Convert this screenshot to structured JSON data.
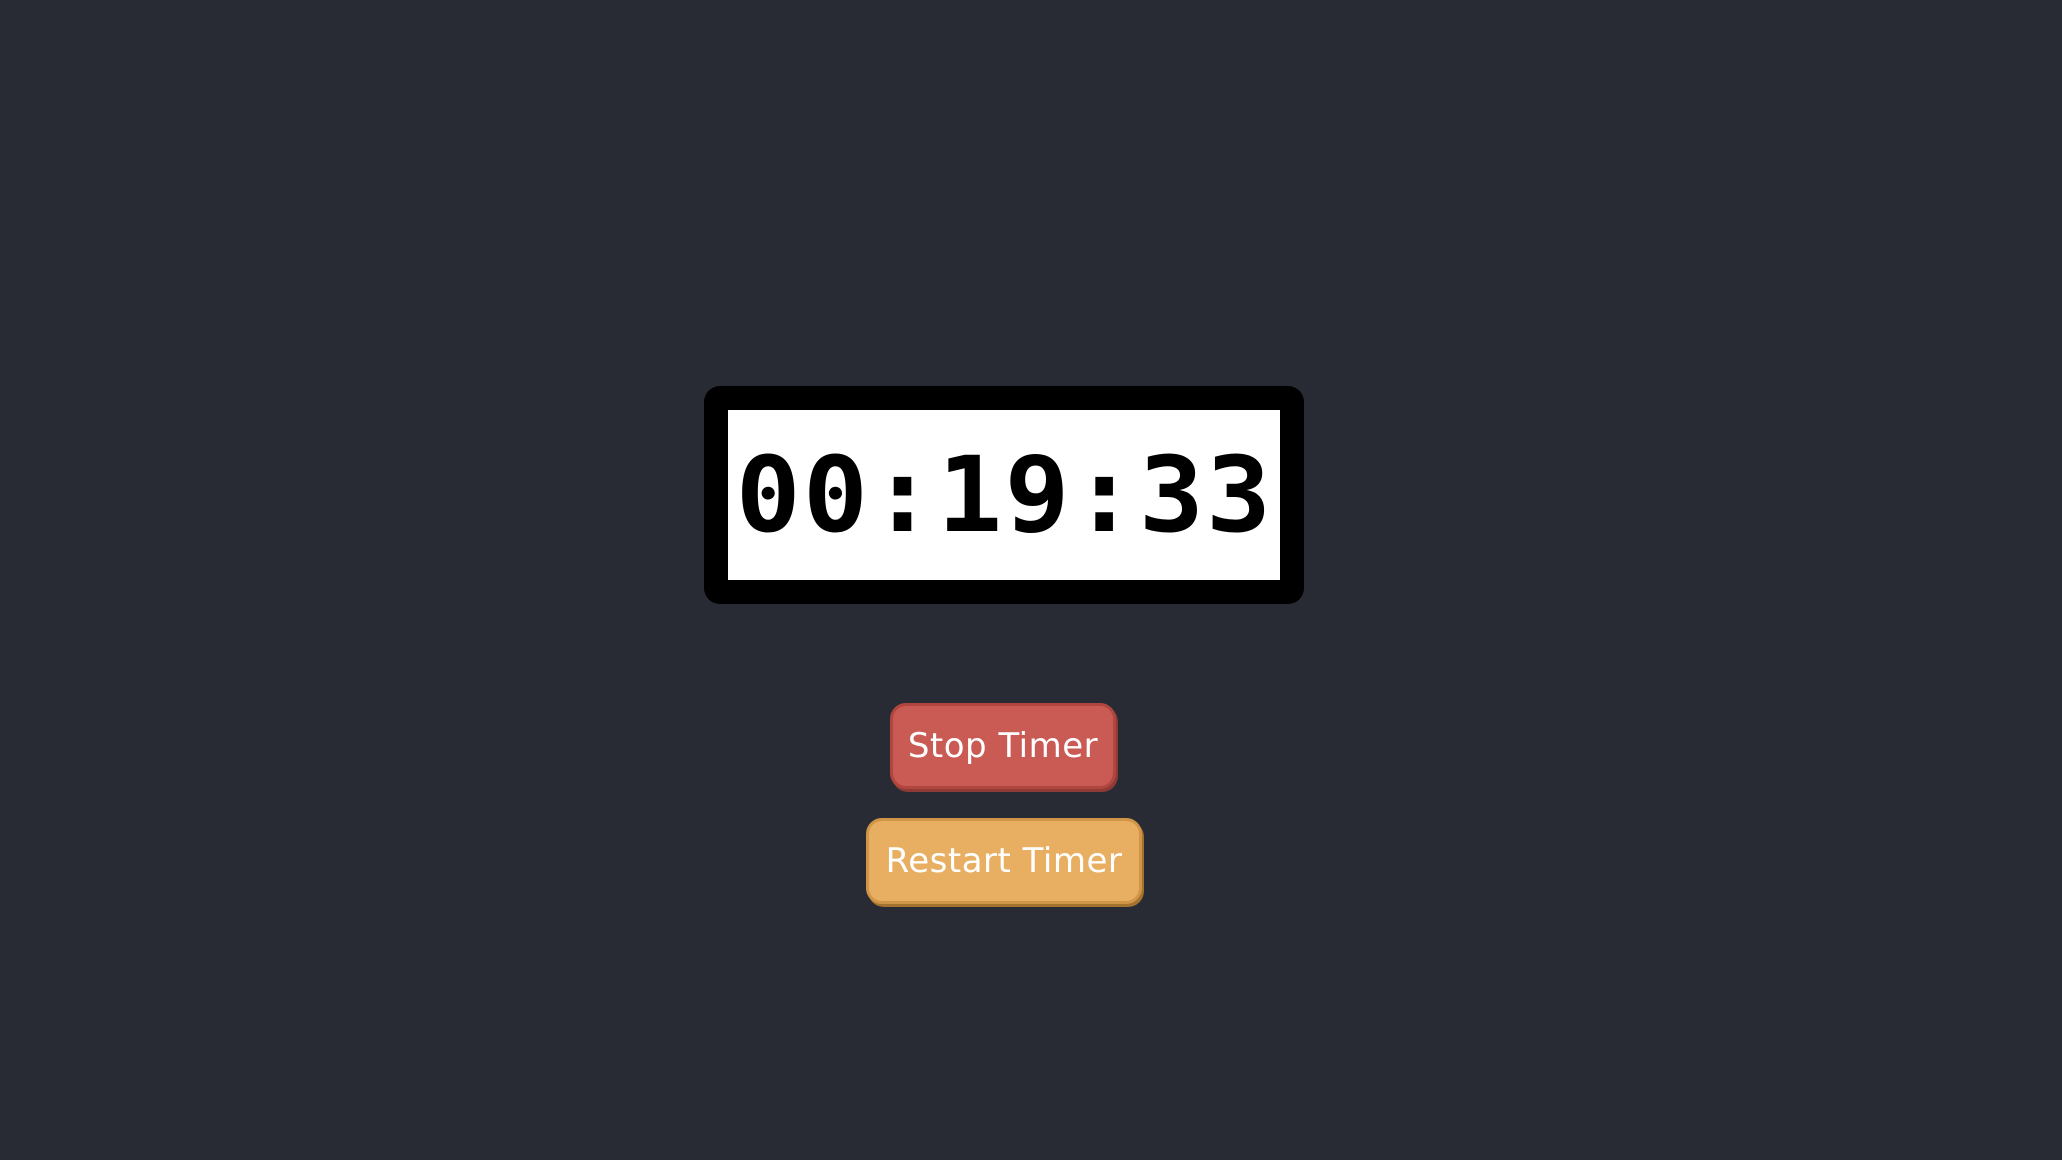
{
  "timer": {
    "display": "00:19:33"
  },
  "buttons": {
    "stop_label": "Stop Timer",
    "restart_label": "Restart Timer"
  },
  "colors": {
    "background": "#282b34",
    "timer_frame": "#000000",
    "timer_face": "#ffffff",
    "stop_button": "#c95a54",
    "restart_button": "#e8ae61",
    "button_text": "#ffffff"
  }
}
